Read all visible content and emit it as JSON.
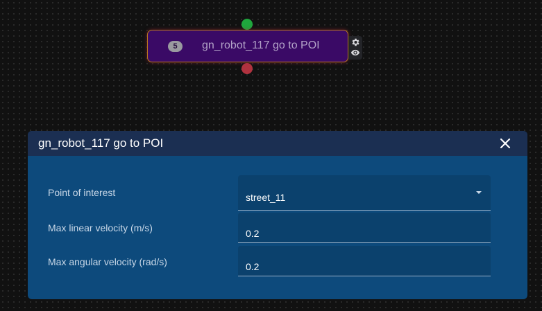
{
  "node": {
    "index": "5",
    "title": "gn_robot_117 go to POI",
    "tools": [
      "gear-icon",
      "eye-icon"
    ],
    "colors": {
      "fill": "#3a0a66",
      "border": "#b8781f",
      "input_handle": "#1fa63d",
      "output_handle": "#b0323f"
    }
  },
  "dialog": {
    "title": "gn_robot_117 go to POI",
    "close_icon": "close-icon",
    "fields": [
      {
        "label": "Point of interest",
        "value": "street_11",
        "type": "select"
      },
      {
        "label": "Max linear velocity (m/s)",
        "value": "0.2",
        "type": "number"
      },
      {
        "label": "Max angular velocity (rad/s)",
        "value": "0.2",
        "type": "number"
      }
    ],
    "colors": {
      "header": "#1b2f52",
      "body": "#0d4a7c"
    }
  }
}
